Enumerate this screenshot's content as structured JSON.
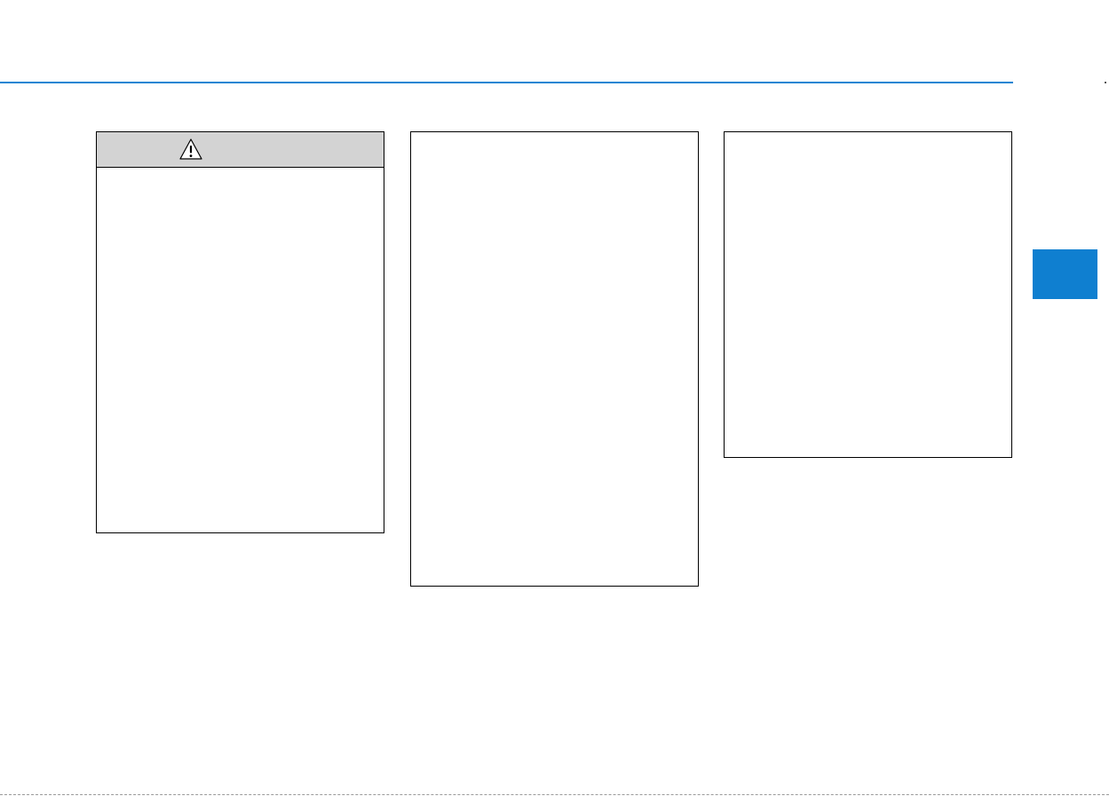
{
  "header": {
    "rule_color": "#1a85d3"
  },
  "warning_box": {
    "icon": "warning-triangle-icon",
    "title": "",
    "body": "",
    "header_color": "#d3d3d3"
  },
  "note_box_1": {
    "body": ""
  },
  "note_box_2": {
    "body": ""
  },
  "section_tab": {
    "label": "",
    "color": "#0f7fd0"
  }
}
